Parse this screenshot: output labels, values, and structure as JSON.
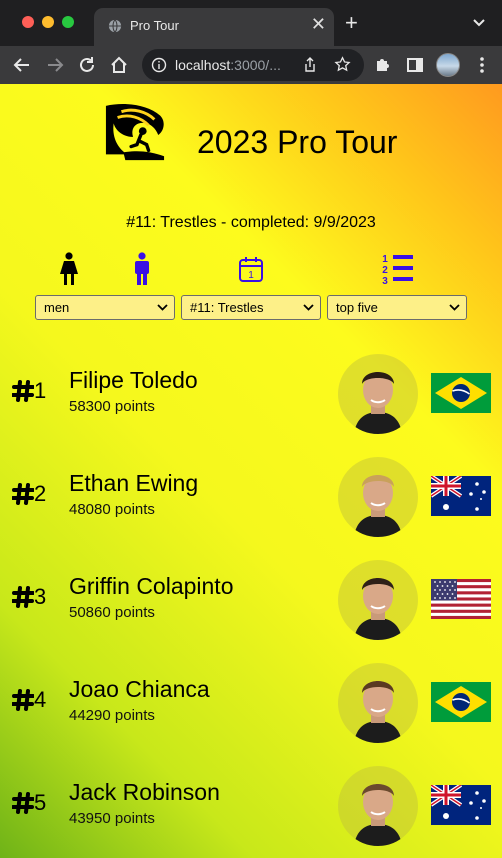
{
  "browser": {
    "tab_title": "Pro Tour",
    "close_glyph": "✕",
    "new_tab_glyph": "+",
    "url_host": "localhost",
    "url_rest": ":3000/..."
  },
  "header": {
    "title": "2023 Pro Tour",
    "logo_icon": "wave-surfer-logo"
  },
  "event": {
    "status": "#11: Trestles - completed: 9/9/2023"
  },
  "filters": {
    "icons": [
      "female-icon",
      "male-icon",
      "calendar-icon",
      "ranked-list-icon"
    ],
    "calendar_day": "1",
    "gender_select": "men",
    "event_select": "#11: Trestles",
    "limit_select": "top five"
  },
  "rankings": [
    {
      "rank": "1",
      "name": "Filipe Toledo",
      "points": "58300 points",
      "country": "brazil"
    },
    {
      "rank": "2",
      "name": "Ethan Ewing",
      "points": "48080 points",
      "country": "australia"
    },
    {
      "rank": "3",
      "name": "Griffin Colapinto",
      "points": "50860 points",
      "country": "usa"
    },
    {
      "rank": "4",
      "name": "Joao Chianca",
      "points": "44290 points",
      "country": "brazil"
    },
    {
      "rank": "5",
      "name": "Jack Robinson",
      "points": "43950 points",
      "country": "australia"
    }
  ],
  "colors": {
    "accent_icon": "#3a10e5",
    "select_bg": "#fdf088"
  }
}
